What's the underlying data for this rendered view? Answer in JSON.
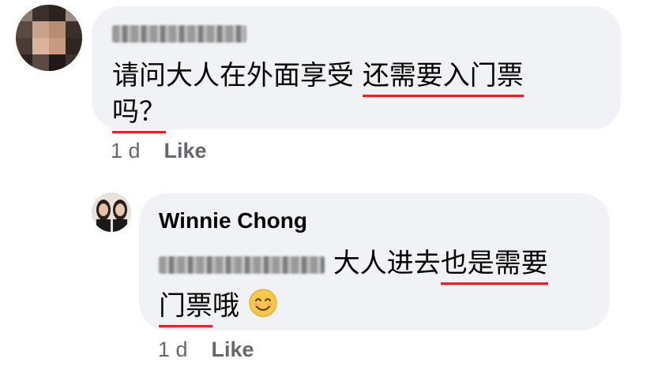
{
  "comments": [
    {
      "author": "Debbie Hui",
      "text_part1": "请问大人在外面享受",
      "text_part2_underlined": "还需要入门票",
      "text_line2_underlined": "吗？",
      "time": "1 d",
      "like_label": "Like"
    },
    {
      "author": "Winnie Chong",
      "mention": "Debbie Hui",
      "text_part1": "大人进去",
      "text_part2_underlined": "也是需要",
      "text_line2_underlined": "门票",
      "text_line2_rest": "哦",
      "emoji": "smiling-face-emoji",
      "time": "1 d",
      "like_label": "Like"
    }
  ],
  "colors": {
    "bubble": "#f0f2f5",
    "underline": "#e0242b",
    "meta": "#65676b"
  }
}
